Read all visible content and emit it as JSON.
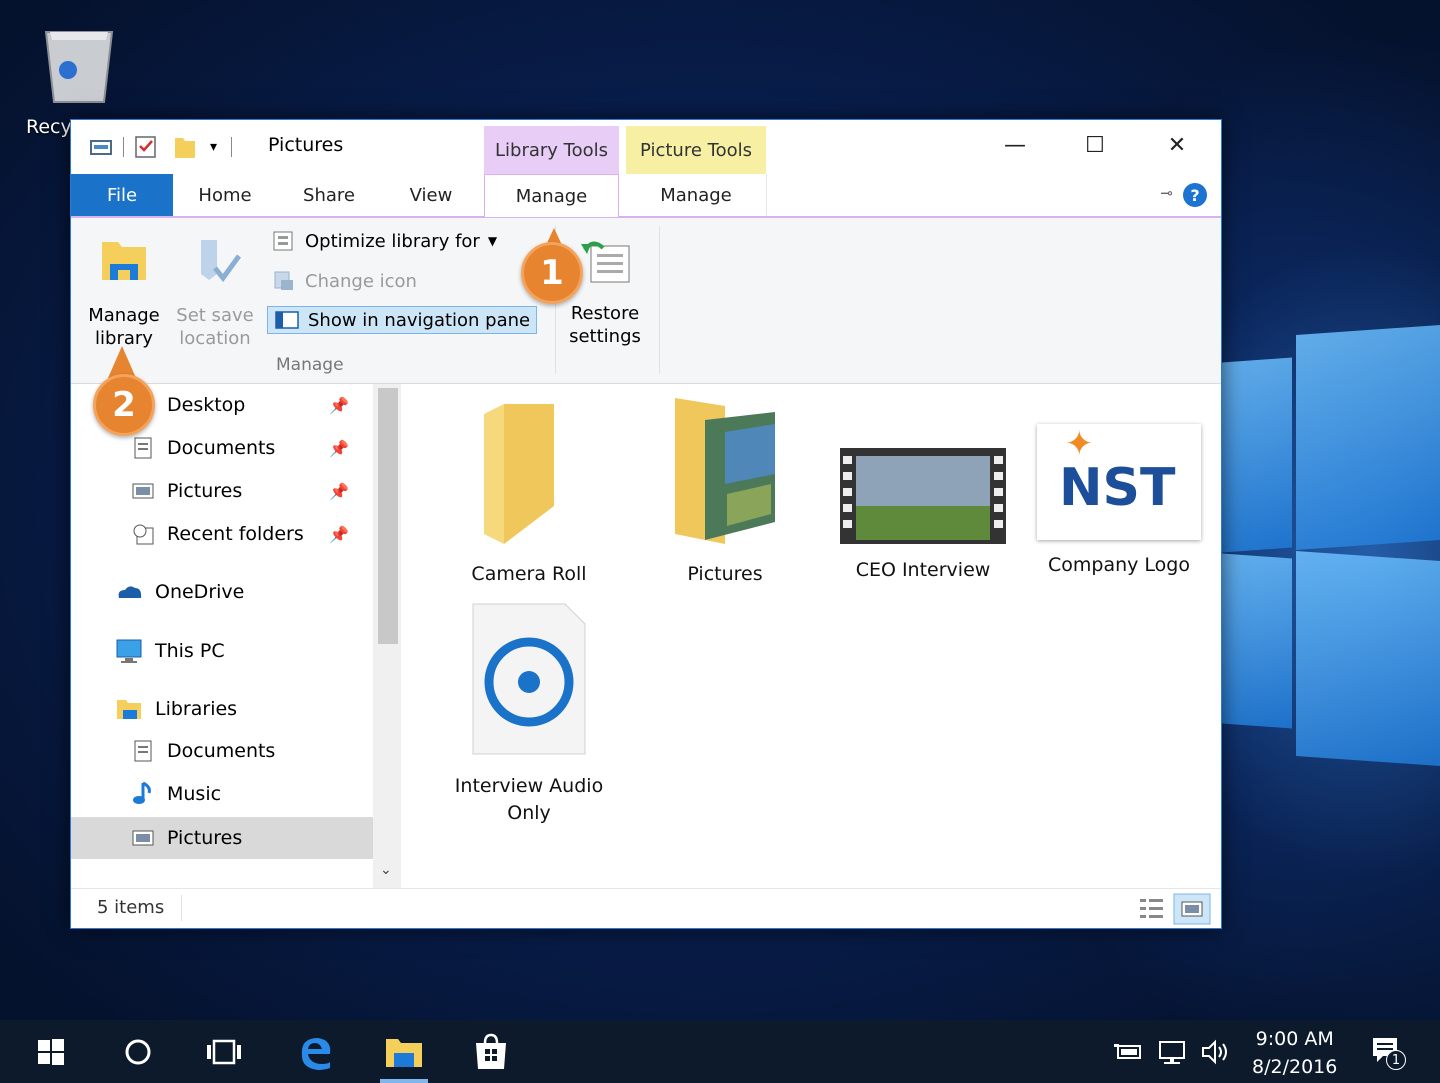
{
  "desktop": {
    "recycle_bin_label": "Recy"
  },
  "window": {
    "title": "Pictures",
    "context_tabs": {
      "library_tools": "Library Tools",
      "picture_tools": "Picture Tools"
    },
    "tabs": [
      "File",
      "Home",
      "Share",
      "View",
      "Manage",
      "Manage"
    ],
    "controls": {
      "minimize": "—",
      "maximize": "☐",
      "close": "✕"
    }
  },
  "ribbon": {
    "manage_library": {
      "line1": "Manage",
      "line2": "library"
    },
    "set_save_location": {
      "line1": "Set save",
      "line2": "location"
    },
    "optimize_library_for": "Optimize library for",
    "change_icon": "Change icon",
    "show_in_navigation_pane": "Show in navigation pane",
    "restore_settings": {
      "line1": "Restore",
      "line2": "settings"
    },
    "group_label": "Manage"
  },
  "nav": {
    "quick_access": [
      {
        "label": "Desktop"
      },
      {
        "label": "Documents"
      },
      {
        "label": "Pictures"
      },
      {
        "label": "Recent folders"
      }
    ],
    "onedrive": "OneDrive",
    "this_pc": "This PC",
    "libraries": "Libraries",
    "library_children": [
      {
        "label": "Documents"
      },
      {
        "label": "Music"
      },
      {
        "label": "Pictures"
      }
    ]
  },
  "content": {
    "items": [
      {
        "label": "Camera Roll"
      },
      {
        "label": "Pictures"
      },
      {
        "label": "CEO Interview"
      },
      {
        "label": "Company Logo"
      },
      {
        "label": "Interview Audio Only"
      }
    ],
    "logo_text": "NST"
  },
  "status": {
    "item_count": "5 items"
  },
  "callouts": {
    "one": "1",
    "two": "2"
  },
  "taskbar": {
    "time": "9:00 AM",
    "date": "8/2/2016",
    "notification_count": "1"
  },
  "colors": {
    "accent": "#1a73c9",
    "callout": "#e7842f",
    "library_tools": "#e8cdf6",
    "picture_tools": "#f7f0a4"
  }
}
